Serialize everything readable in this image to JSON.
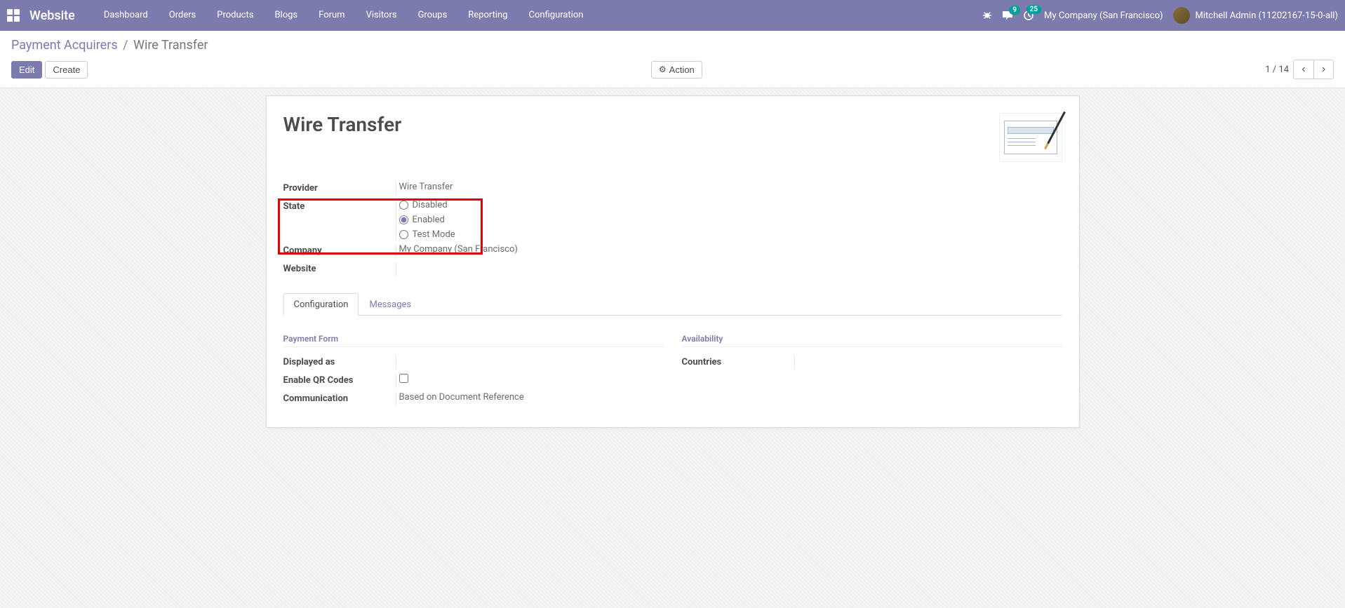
{
  "navbar": {
    "brand": "Website",
    "menu": [
      "Dashboard",
      "Orders",
      "Products",
      "Blogs",
      "Forum",
      "Visitors",
      "Groups",
      "Reporting",
      "Configuration"
    ],
    "messages_badge": "9",
    "activities_badge": "25",
    "company": "My Company (San Francisco)",
    "user": "Mitchell Admin (11202167-15-0-all)"
  },
  "breadcrumb": {
    "parent": "Payment Acquirers",
    "current": "Wire Transfer"
  },
  "buttons": {
    "edit": "Edit",
    "create": "Create",
    "action": "Action"
  },
  "pager": {
    "text": "1 / 14"
  },
  "record": {
    "title": "Wire Transfer",
    "labels": {
      "provider": "Provider",
      "state": "State",
      "company": "Company",
      "website": "Website"
    },
    "provider": "Wire Transfer",
    "state_options": {
      "disabled": "Disabled",
      "enabled": "Enabled",
      "test": "Test Mode"
    },
    "state_selected": "enabled",
    "company": "My Company (San Francisco)",
    "website": ""
  },
  "tabs": {
    "config": "Configuration",
    "messages": "Messages"
  },
  "config": {
    "section_payment": "Payment Form",
    "section_availability": "Availability",
    "labels": {
      "displayed_as": "Displayed as",
      "enable_qr": "Enable QR Codes",
      "communication": "Communication",
      "countries": "Countries"
    },
    "displayed_as": "",
    "enable_qr": false,
    "communication": "Based on Document Reference",
    "countries": ""
  }
}
